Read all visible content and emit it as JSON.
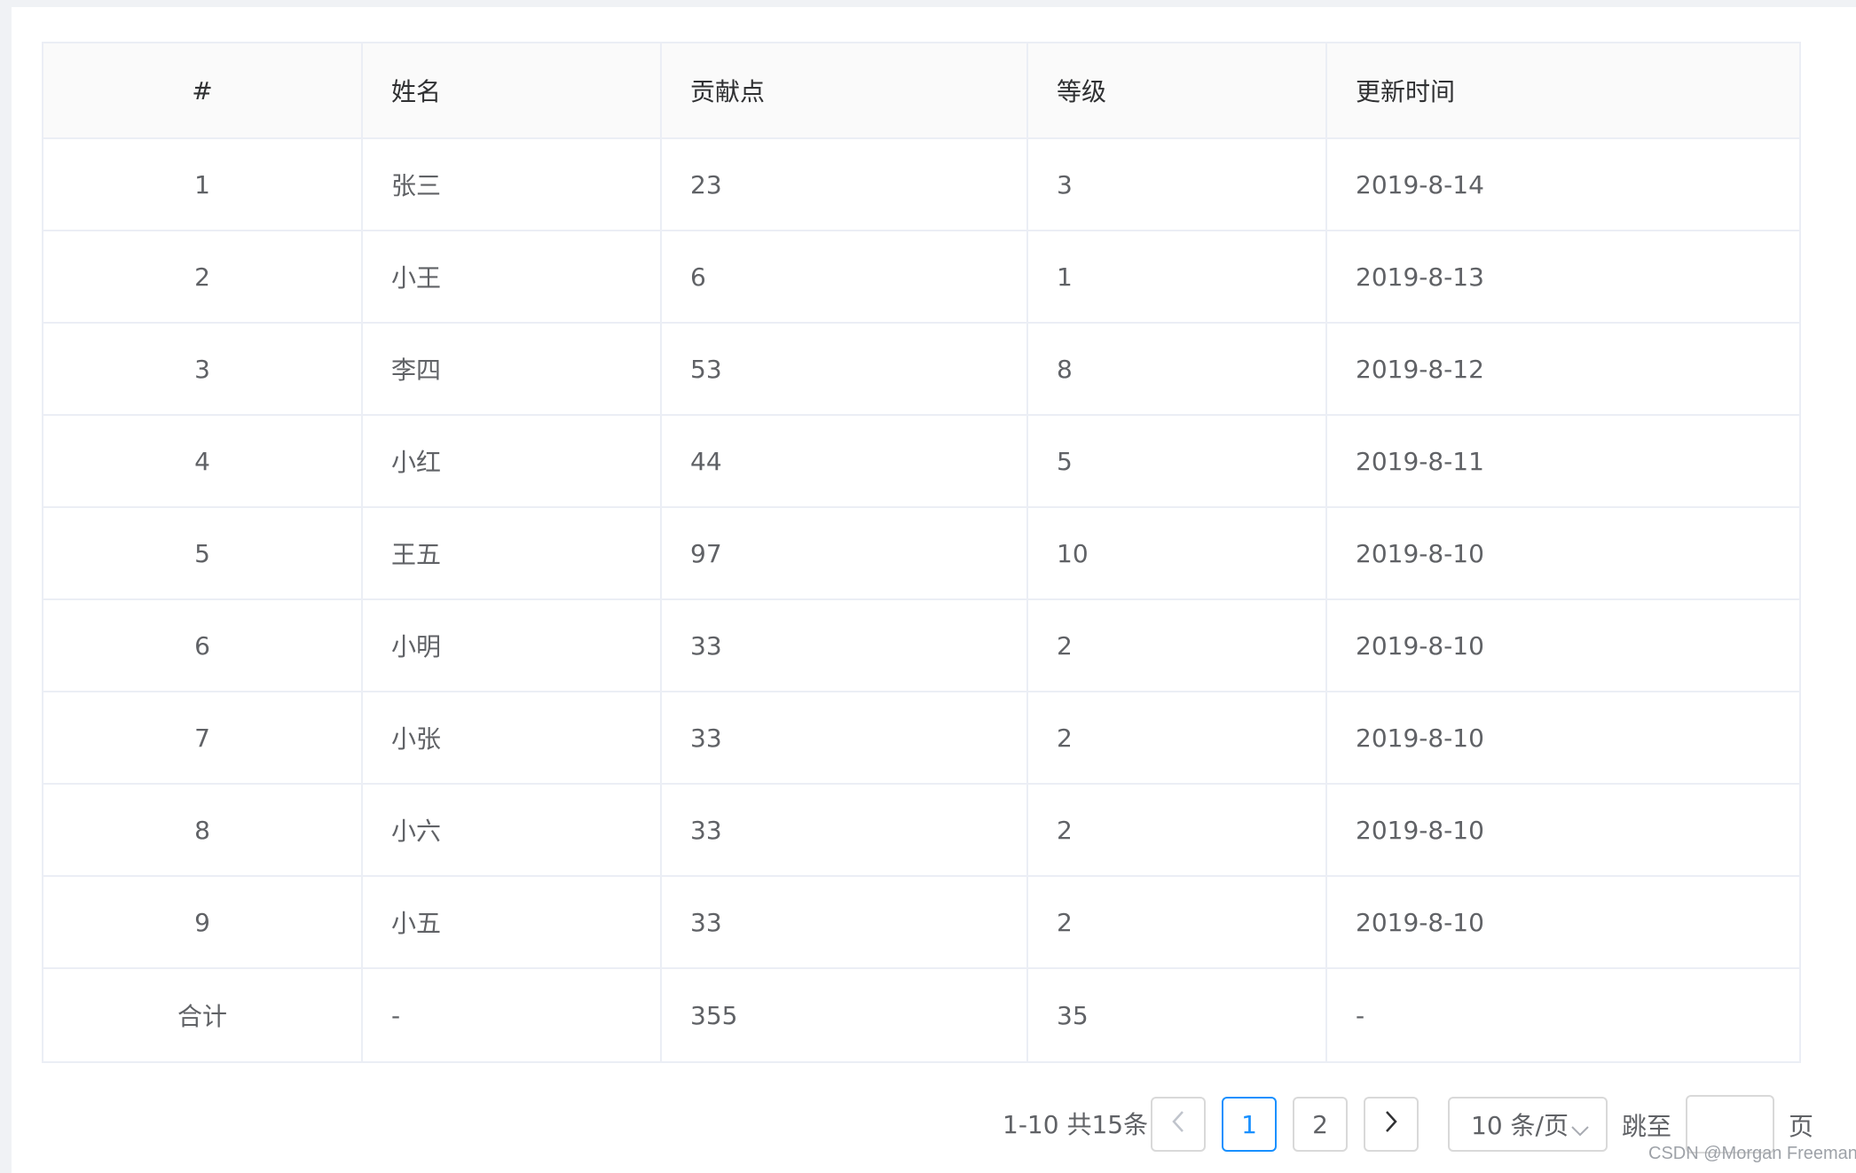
{
  "table": {
    "headers": [
      "#",
      "姓名",
      "贡献点",
      "等级",
      "更新时间"
    ],
    "rows": [
      [
        "1",
        "张三",
        "23",
        "3",
        "2019-8-14"
      ],
      [
        "2",
        "小王",
        "6",
        "1",
        "2019-8-13"
      ],
      [
        "3",
        "李四",
        "53",
        "8",
        "2019-8-12"
      ],
      [
        "4",
        "小红",
        "44",
        "5",
        "2019-8-11"
      ],
      [
        "5",
        "王五",
        "97",
        "10",
        "2019-8-10"
      ],
      [
        "6",
        "小明",
        "33",
        "2",
        "2019-8-10"
      ],
      [
        "7",
        "小张",
        "33",
        "2",
        "2019-8-10"
      ],
      [
        "8",
        "小六",
        "33",
        "2",
        "2019-8-10"
      ],
      [
        "9",
        "小五",
        "33",
        "2",
        "2019-8-10"
      ]
    ],
    "summary": [
      "合计",
      "-",
      "355",
      "35",
      "-"
    ]
  },
  "pagination": {
    "total_text": "1-10 共15条",
    "pages": [
      "1",
      "2"
    ],
    "current_page": "1",
    "page_size": "10 条/页",
    "jump_label": "跳至",
    "jump_value": "",
    "page_suffix": "页"
  },
  "watermark": "CSDN @Morgan Freeman",
  "colors": {
    "accent": "#1890ff",
    "border": "#ebeef5",
    "header_bg": "#fafafa",
    "text": "#606266"
  },
  "icons": {
    "prev": "chevron-left-icon",
    "next": "chevron-right-icon",
    "size_dropdown": "chevron-down-icon"
  }
}
